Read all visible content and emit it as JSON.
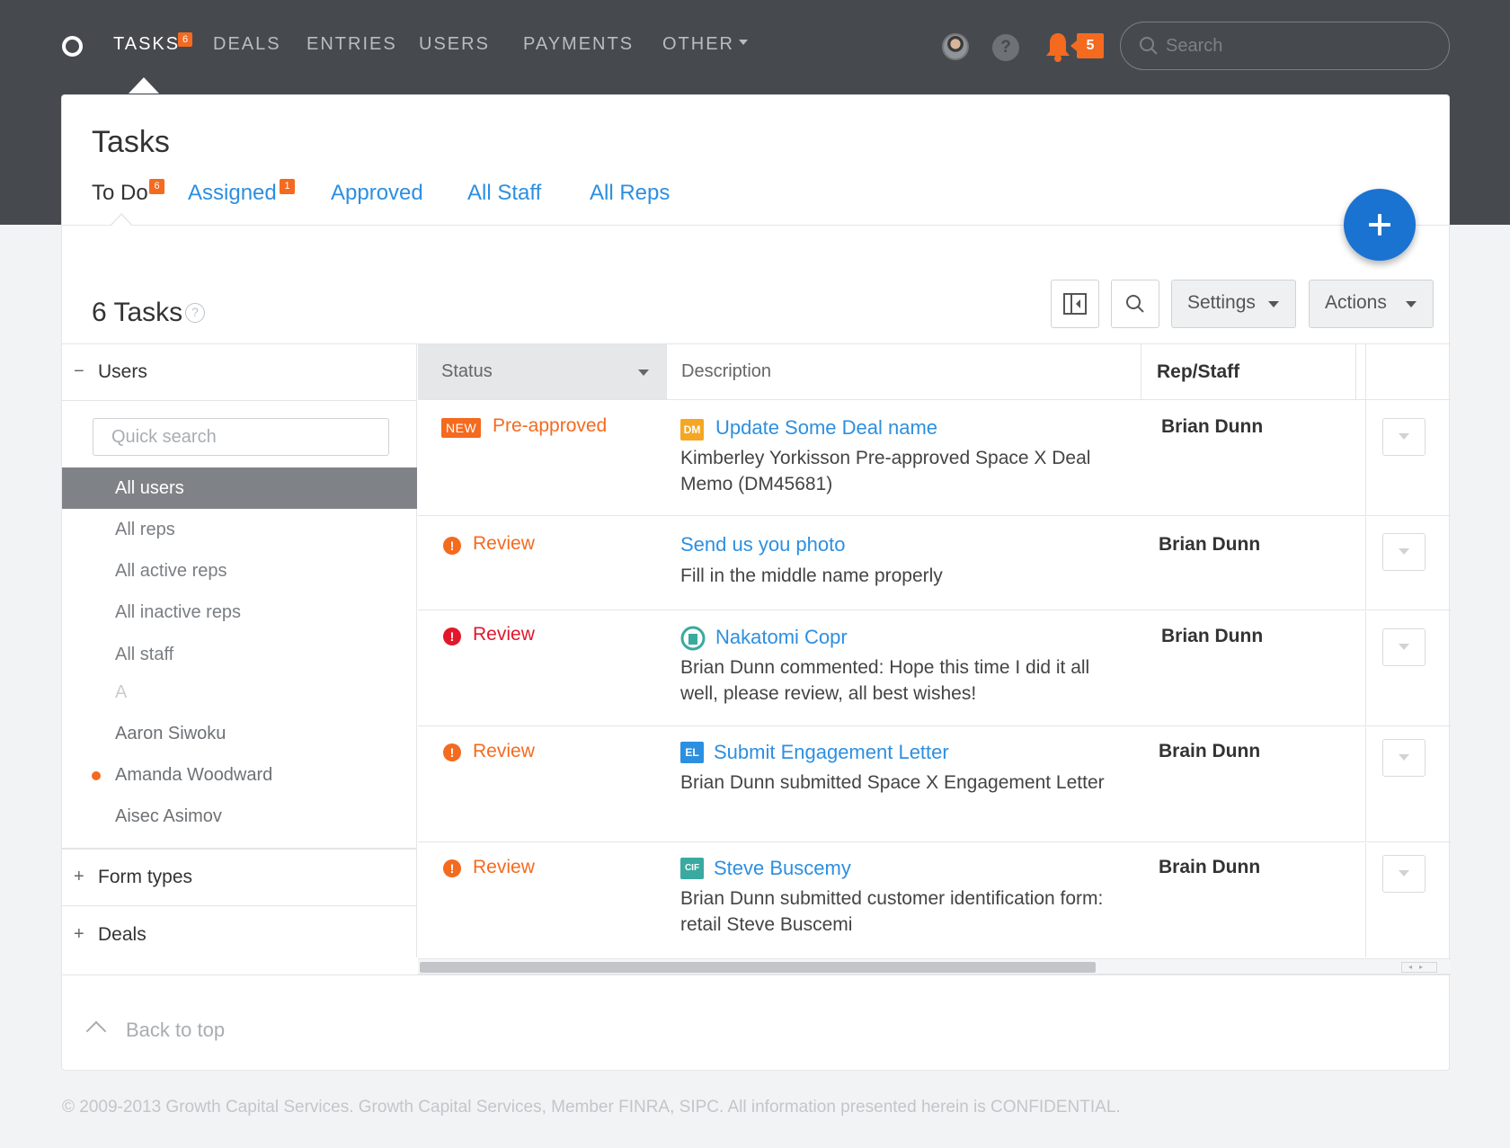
{
  "nav": {
    "items": [
      {
        "label": "TASKS",
        "badge": "6",
        "active": true
      },
      {
        "label": "DEALS"
      },
      {
        "label": "ENTRIES"
      },
      {
        "label": "USERS"
      },
      {
        "label": "PAYMENTS"
      },
      {
        "label": "OTHER"
      }
    ],
    "help": "?",
    "notification_count": "5",
    "search_placeholder": "Search"
  },
  "page": {
    "title": "Tasks",
    "tabs": [
      {
        "label": "To Do",
        "badge": "6",
        "active": true
      },
      {
        "label": "Assigned",
        "badge": "1"
      },
      {
        "label": "Approved"
      },
      {
        "label": "All Staff"
      },
      {
        "label": "All Reps"
      }
    ],
    "count_label": "6 Tasks",
    "help": "?",
    "settings_label": "Settings",
    "actions_label": "Actions"
  },
  "filters": {
    "users_label": "Users",
    "users_sign": "−",
    "quick_search_placeholder": "Quick search",
    "user_items": [
      "All users",
      "All reps",
      "All active reps",
      "All inactive reps",
      "All staff",
      "A",
      "Aaron Siwoku",
      "Amanda Woodward",
      "Aisec Asimov"
    ],
    "form_types_label": "Form types",
    "deals_label": "Deals",
    "collapsed_sign": "+"
  },
  "table": {
    "headers": {
      "status": "Status",
      "description": "Description",
      "rep": "Rep/Staff"
    },
    "rows": [
      {
        "new_badge": "NEW",
        "status": "Pre-approved",
        "status_color": "orange",
        "icon_text": "DM",
        "icon_color": "#f5a623",
        "title": "Update Some Deal name",
        "text": "Kimberley Yorkisson Pre-approved Space X Deal Memo (DM45681)",
        "rep": "Brian Dunn"
      },
      {
        "status": "Review",
        "status_color": "orange",
        "title": "Send us you photo",
        "text": "Fill in the middle name properly",
        "rep": "Brian Dunn"
      },
      {
        "status": "Review",
        "status_color": "red",
        "icon_color": "#3aa99f",
        "title": "Nakatomi Copr",
        "text": "Brian Dunn commented: Hope this time I did it all well, please review, all best wishes!",
        "rep": "Brian Dunn"
      },
      {
        "status": "Review",
        "status_color": "orange",
        "icon_text": "EL",
        "icon_color": "#2d8fe0",
        "title": "Submit Engagement Letter",
        "text": "Brian Dunn submitted Space X Engagement Letter",
        "rep": "Brain Dunn"
      },
      {
        "status": "Review",
        "status_color": "orange",
        "icon_text": "CIF",
        "icon_color": "#3aa99f",
        "title": "Steve Buscemy",
        "text": "Brian Dunn submitted customer identification form: retail Steve Buscemi",
        "rep": "Brain Dunn"
      }
    ],
    "warn_glyph": "!"
  },
  "back_to_top": "Back to top",
  "footer": "© 2009-2013 Growth Capital Services.  Growth Capital Services, Member FINRA, SIPC. All information presented herein is CONFIDENTIAL.",
  "colors": {
    "accent": "#2d8fe0",
    "badge": "#f46a1f",
    "header_bg": "#464a4f",
    "fab": "#1a73d1",
    "alert_red": "#e2172b"
  }
}
